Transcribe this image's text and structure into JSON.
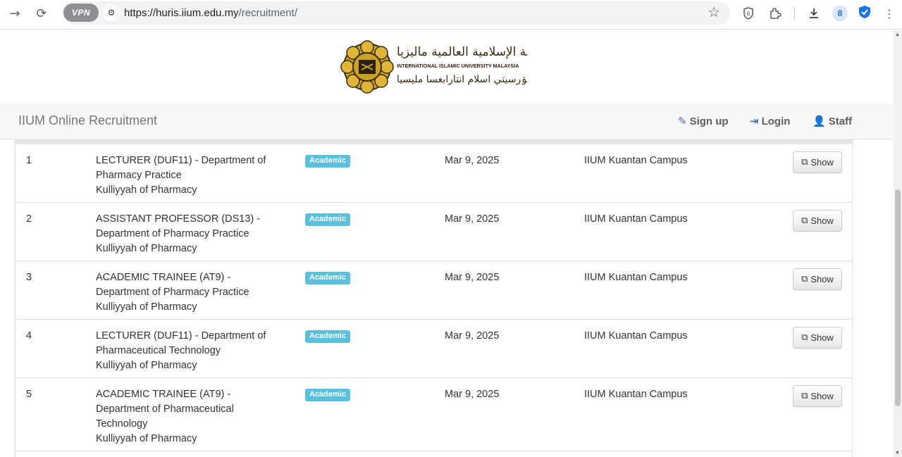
{
  "browser": {
    "url_host": "https://huris.iium.edu.my",
    "url_path": "/recruitment/",
    "vpn_label": "VPN",
    "profile_initial": "8"
  },
  "site": {
    "logo_arabic_top": "الجامعة الإسلامية العالمية ماليزيا",
    "logo_english": "INTERNATIONAL ISLAMIC UNIVERSITY MALAYSIA",
    "logo_arabic_bottom": "يونيۏرسيتي اسلام انتارابغسا مليسيا",
    "brand": "IIUM Online Recruitment",
    "nav": {
      "signup": "Sign up",
      "login": "Login",
      "staff": "Staff"
    }
  },
  "colors": {
    "badge": "#5bc0de",
    "navbar_bg": "#f8f8f8",
    "logo_gold": "#c9a227"
  },
  "jobs": [
    {
      "no": "1",
      "title": "LECTURER (DUF11) - Department of Pharmacy Practice",
      "kulliyyah": "Kulliyyah of Pharmacy",
      "category": "Academic",
      "date": "Mar 9, 2025",
      "campus": "IIUM Kuantan Campus",
      "action": "Show"
    },
    {
      "no": "2",
      "title": "ASSISTANT PROFESSOR (DS13) - Department of Pharmacy Practice",
      "kulliyyah": "Kulliyyah of Pharmacy",
      "category": "Academic",
      "date": "Mar 9, 2025",
      "campus": "IIUM Kuantan Campus",
      "action": "Show"
    },
    {
      "no": "3",
      "title": "ACADEMIC TRAINEE (AT9) - Department of Pharmacy Practice",
      "kulliyyah": "Kulliyyah of Pharmacy",
      "category": "Academic",
      "date": "Mar 9, 2025",
      "campus": "IIUM Kuantan Campus",
      "action": "Show"
    },
    {
      "no": "4",
      "title": "LECTURER (DUF11) - Department of Pharmaceutical Technology",
      "kulliyyah": "Kulliyyah of Pharmacy",
      "category": "Academic",
      "date": "Mar 9, 2025",
      "campus": "IIUM Kuantan Campus",
      "action": "Show"
    },
    {
      "no": "5",
      "title": "ACADEMIC TRAINEE (AT9) - Department of Pharmaceutical Technology",
      "kulliyyah": "Kulliyyah of Pharmacy",
      "category": "Academic",
      "date": "Mar 9, 2025",
      "campus": "IIUM Kuantan Campus",
      "action": "Show"
    }
  ]
}
